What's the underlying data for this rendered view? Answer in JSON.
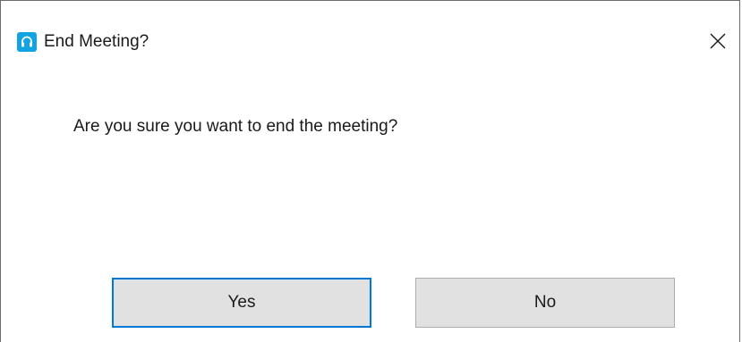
{
  "dialog": {
    "title": "End Meeting?",
    "app_icon": "headset-icon",
    "close_icon": "close-icon",
    "message": "Are you sure you want to end the meeting?"
  },
  "buttons": {
    "yes_label": "Yes",
    "no_label": "No"
  },
  "colors": {
    "app_icon_bg": "#12a3e3",
    "focused_button_border": "#0078d7",
    "button_bg": "#e1e1e1"
  }
}
